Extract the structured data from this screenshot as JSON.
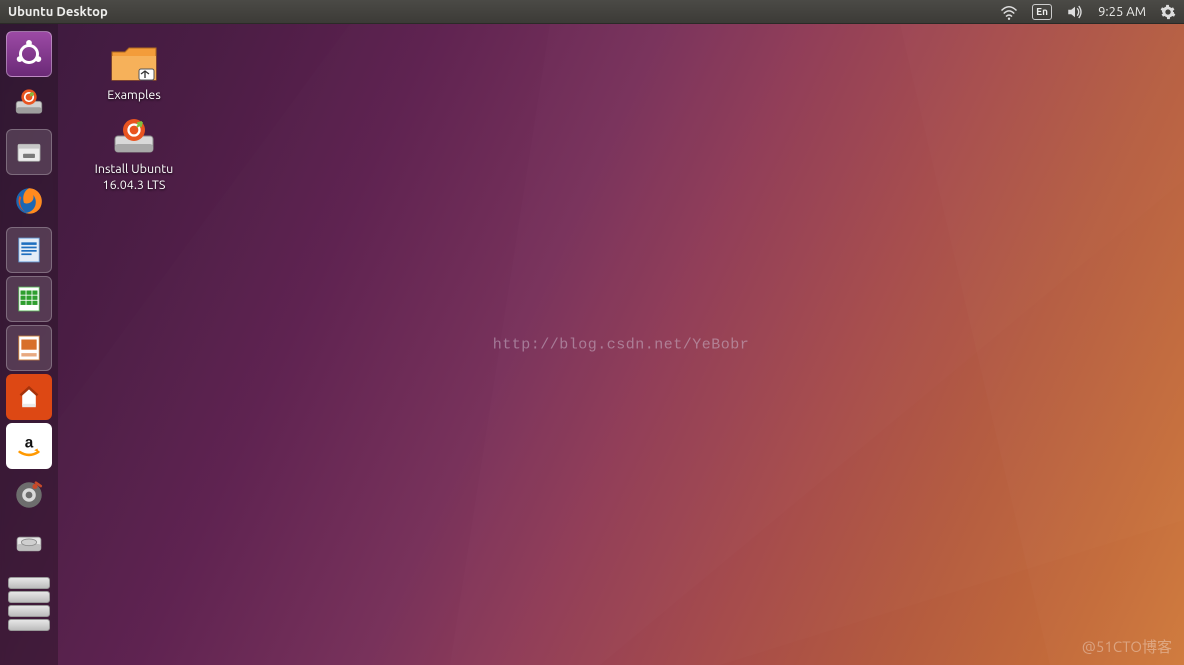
{
  "menubar": {
    "title": "Ubuntu Desktop",
    "language": "En",
    "clock": "9:25 AM"
  },
  "launcher": {
    "items": [
      {
        "name": "dash",
        "label": "Dash"
      },
      {
        "name": "install-ubuntu",
        "label": "Install Ubuntu"
      },
      {
        "name": "files",
        "label": "Files"
      },
      {
        "name": "firefox",
        "label": "Firefox Web Browser"
      },
      {
        "name": "libreoffice-writer",
        "label": "LibreOffice Writer"
      },
      {
        "name": "libreoffice-calc",
        "label": "LibreOffice Calc"
      },
      {
        "name": "libreoffice-impress",
        "label": "LibreOffice Impress"
      },
      {
        "name": "ubuntu-software",
        "label": "Ubuntu Software"
      },
      {
        "name": "amazon",
        "label": "Amazon"
      },
      {
        "name": "system-settings",
        "label": "System Settings"
      },
      {
        "name": "disk",
        "label": "Removable Media"
      },
      {
        "name": "expand",
        "label": "More"
      }
    ]
  },
  "desktop": {
    "icons": [
      {
        "name": "examples-folder",
        "label": "Examples"
      },
      {
        "name": "install-ubuntu",
        "label": "Install Ubuntu\n16.04.3 LTS"
      }
    ]
  },
  "watermarks": {
    "center": "http://blog.csdn.net/YeBobr",
    "corner": "@51CTO博客"
  }
}
